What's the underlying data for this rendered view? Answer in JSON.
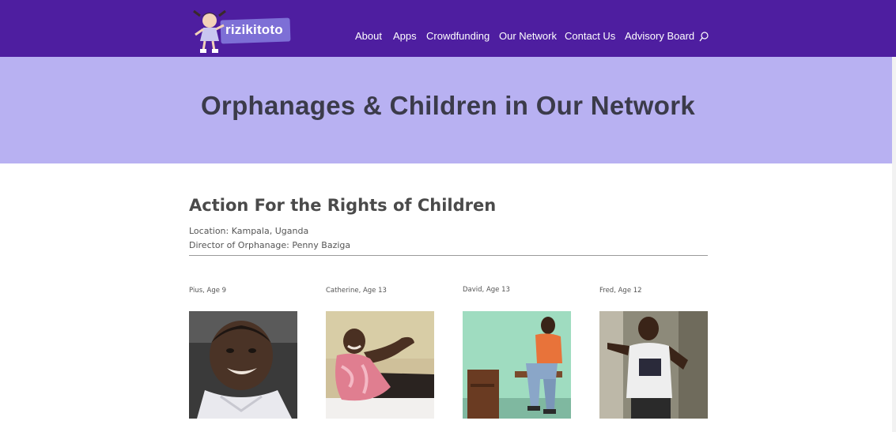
{
  "header": {
    "logo_text": "rizikitoto",
    "nav": [
      "About",
      "Apps",
      "Crowdfunding",
      "Our Network",
      "Contact Us",
      "Advisory Board"
    ],
    "colors": {
      "bar": "#4e1ea0",
      "hero": "#b8b1f2"
    }
  },
  "hero": {
    "title": "Orphanages & Children in Our Network"
  },
  "orphanage": {
    "name": "Action For the Rights of Children",
    "location": "Location: Kampala, Uganda",
    "director": "Director of Orphanage: Penny Baziga"
  },
  "children": [
    {
      "label": "Pius, Age 9"
    },
    {
      "label": "Catherine, Age 13"
    },
    {
      "label": "David, Age 13"
    },
    {
      "label": "Fred, Age 12"
    }
  ]
}
